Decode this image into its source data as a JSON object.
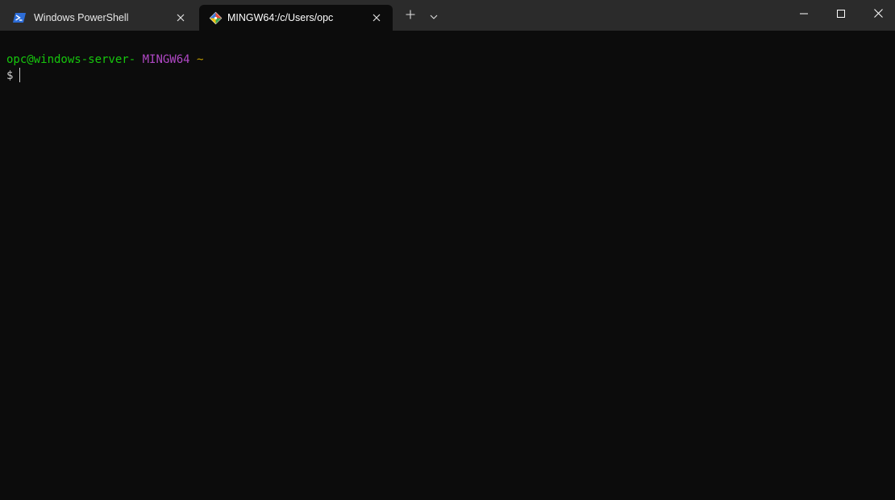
{
  "tabs": [
    {
      "label": "Windows PowerShell",
      "icon": "powershell-icon",
      "active": false
    },
    {
      "label": "MINGW64:/c/Users/opc",
      "icon": "git-icon",
      "active": true
    }
  ],
  "titlebar": {
    "new_tab_icon": "plus-icon",
    "dropdown_icon": "chevron-down-icon",
    "window_controls": [
      "minimize-icon",
      "maximize-icon",
      "close-icon"
    ]
  },
  "terminal": {
    "prompt_user_host": "opc@windows-server-",
    "prompt_system": "MINGW64",
    "prompt_path": "~",
    "prompt_symbol": "$",
    "input": ""
  },
  "colors": {
    "titlebar_bg": "#2b2b2b",
    "terminal_bg": "#0c0c0c",
    "user_host": "#16c60c",
    "system": "#b148c6",
    "path": "#c19c00",
    "text": "#cccccc"
  }
}
